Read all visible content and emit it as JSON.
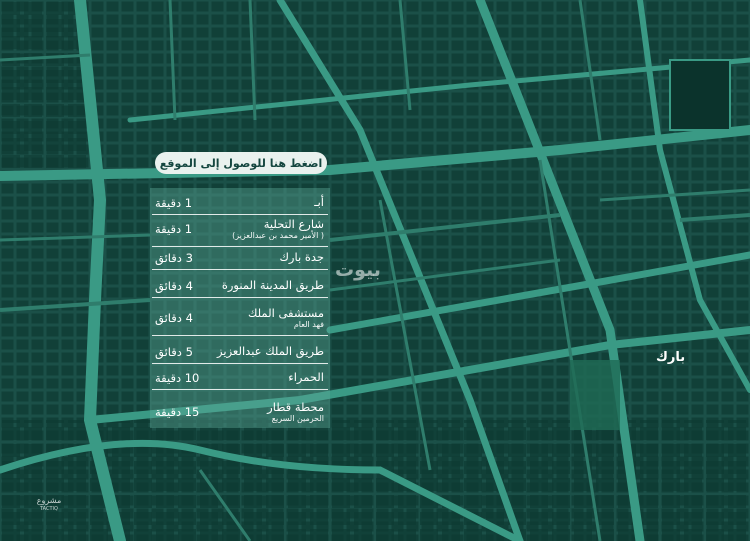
{
  "map": {
    "colors": {
      "background": "#184a42",
      "block": "#0f3d35",
      "road_major": "#3a9a85",
      "road_minor": "#2f7d6c",
      "panel": "#5ca896",
      "accent_light": "#e9f1ee"
    },
    "watermark": "بيوت",
    "landmark_label": "بارك"
  },
  "cta": {
    "label": "اضغط هنا للوصول إلى الموقع"
  },
  "destinations": [
    {
      "name": "أبـ",
      "time": "1 دقيقة"
    },
    {
      "name": "شارع التحلية",
      "sub": "( الأمير محمد بن عبدالعزيز)",
      "time": "1 دقيقة"
    },
    {
      "name": "جدة بارك",
      "time": "3 دقائق"
    },
    {
      "name": "طريق المدينة المنورة",
      "time": "4 دقائق"
    },
    {
      "name": "مستشفى الملك",
      "sub": "فهد العام",
      "time": "4 دقائق"
    },
    {
      "name": "طريق الملك عبدالعزيز",
      "time": "5 دقائق"
    },
    {
      "name": "الحمراء",
      "time": "10 دقيقة"
    },
    {
      "name": "محطة قطار",
      "sub": "الحرمين السريع",
      "time": "15 دقيقة"
    }
  ],
  "brand": {
    "mark": "مشروع",
    "text": "TACTIQ"
  }
}
